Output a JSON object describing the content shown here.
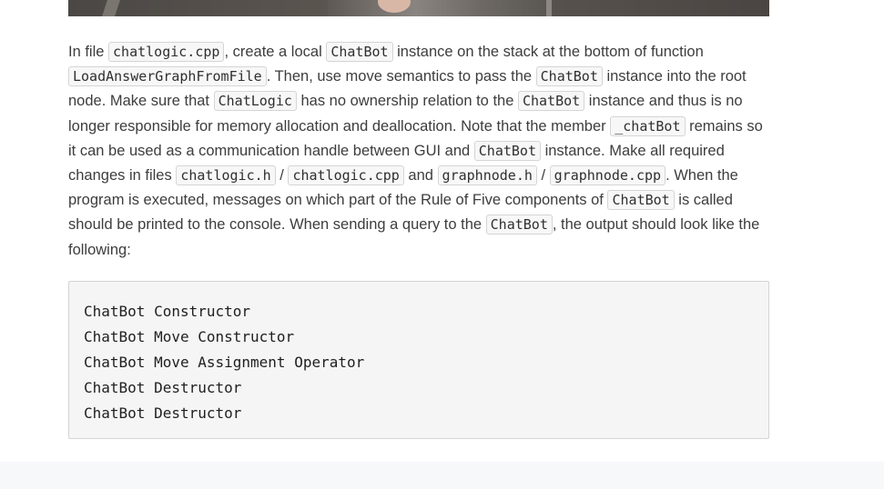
{
  "hero": {
    "description": ""
  },
  "paragraph": {
    "t1": "In file ",
    "c1": "chatlogic.cpp",
    "t2": ", create a local ",
    "c2": "ChatBot",
    "t3": " instance on the stack at the bottom of function ",
    "c3": "LoadAnswerGraphFromFile",
    "t4": ". Then, use move semantics to pass the ",
    "c4": "ChatBot",
    "t5": " instance into the root node. Make sure that ",
    "c5": "ChatLogic",
    "t6": " has no ownership relation to the ",
    "c6": "ChatBot",
    "t7": " instance and thus is no longer responsible for memory allocation and deallocation. Note that the member ",
    "c7": "_chatBot",
    "t8": " remains so it can be used as a communication handle between GUI and ",
    "c8": "ChatBot",
    "t9": " instance. Make all required changes in files ",
    "c9": "chatlogic.h",
    "t10": " / ",
    "c10": "chatlogic.cpp",
    "t11": " and ",
    "c11": "graphnode.h",
    "t12": " / ",
    "c12": "graphnode.cpp",
    "t13": ". When the program is executed, messages on which part of the Rule of Five components of ",
    "c13": "ChatBot",
    "t14": " is called should be printed to the console. When sending a query to the ",
    "c14": "ChatBot",
    "t15": ", the output should look like the following:"
  },
  "code_block": {
    "lines": [
      "ChatBot Constructor",
      "ChatBot Move Constructor",
      "ChatBot Move Assignment Operator",
      "ChatBot Destructor",
      "ChatBot Destructor"
    ]
  },
  "colors": {
    "text": "#3d3d3d",
    "code_bg": "#f5f5f5",
    "code_border": "#d4d4d4",
    "inline_code_border": "#d5d5d5",
    "footer_bg": "#f7f8fa"
  }
}
